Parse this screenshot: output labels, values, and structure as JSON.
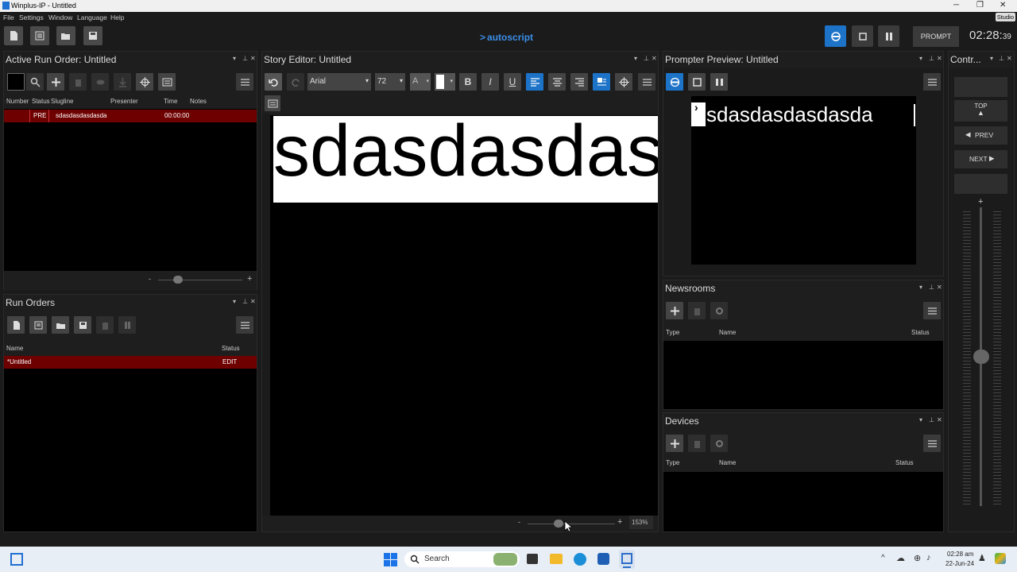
{
  "window": {
    "title": "Winplus-IP - Untitled",
    "studio_badge": "Studio"
  },
  "menu": {
    "items": [
      "File",
      "Settings",
      "Window",
      "Language",
      "Help"
    ]
  },
  "toolbar": {
    "logo": "autoscript",
    "prompt_label": "PROMPT",
    "clock_main": "02:28:",
    "clock_seconds": "39"
  },
  "run_order": {
    "title": "Active Run Order: Untitled",
    "columns": [
      "Number",
      "Status",
      "Slugline",
      "Presenter",
      "Time",
      "Notes"
    ],
    "rows": [
      {
        "number": "",
        "status": "PRE",
        "slugline": "sdasdasdasdasda",
        "presenter": "",
        "time": "00:00:00",
        "notes": ""
      }
    ],
    "zoom_minus": "-",
    "zoom_plus": "+"
  },
  "run_orders": {
    "title": "Run Orders",
    "columns": [
      "Name",
      "Status"
    ],
    "rows": [
      {
        "name": "*Untitled",
        "status": "EDIT"
      }
    ]
  },
  "story_editor": {
    "title": "Story Editor: Untitled",
    "font": "Arial",
    "size": "72",
    "color_label": "A",
    "format_buttons": [
      "B",
      "I",
      "U"
    ],
    "text": "sdasdasdasdasda",
    "zoom": "153%",
    "zoom_minus": "-",
    "zoom_plus": "+"
  },
  "prompter_preview": {
    "title": "Prompter Preview: Untitled",
    "text": "sdasdasdasdasda"
  },
  "newsrooms": {
    "title": "Newsrooms",
    "columns": [
      "Type",
      "Name",
      "Status"
    ]
  },
  "devices": {
    "title": "Devices",
    "columns": [
      "Type",
      "Name",
      "Status"
    ]
  },
  "controller": {
    "title": "Contr...",
    "top": "TOP",
    "prev": "PREV",
    "next": "NEXT",
    "plus": "+"
  },
  "taskbar": {
    "search": "Search",
    "time": "02:28 am",
    "date": "22-Jun-24"
  }
}
